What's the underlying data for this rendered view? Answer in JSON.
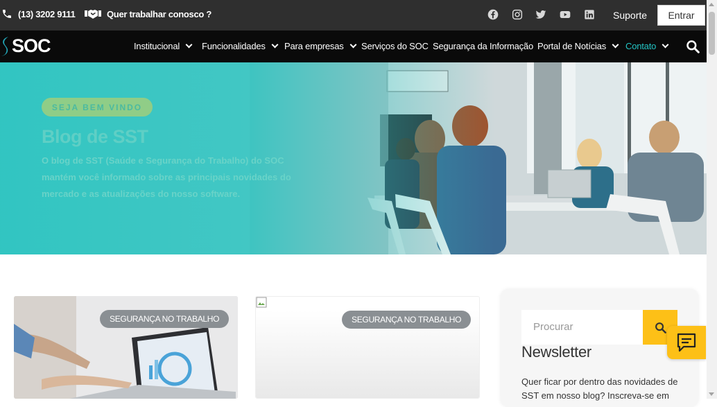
{
  "topbar": {
    "phone": "(13) 3202 9111",
    "work": "Quer trabalhar conosco ?",
    "social": [
      "facebook-icon",
      "instagram-icon",
      "twitter-icon",
      "youtube-icon",
      "linkedin-icon"
    ],
    "suporte": "Suporte",
    "entrar": "Entrar"
  },
  "navbar": {
    "logo": "SOC",
    "items": [
      {
        "label": "Institucional",
        "dropdown": true
      },
      {
        "label": "Funcionalidades",
        "dropdown": true
      },
      {
        "label": "Para empresas",
        "dropdown": true
      },
      {
        "label": "Serviços do SOC",
        "dropdown": false
      },
      {
        "label": "Segurança da Informação",
        "dropdown": false
      },
      {
        "label": "Portal de Notícias",
        "dropdown": true
      },
      {
        "label": "Contato",
        "dropdown": true,
        "active": true
      }
    ]
  },
  "hero": {
    "badge": "SEJA BEM VINDO",
    "title": "Blog de SST",
    "text": "O blog de SST (Saúde e Segurança do Trabalho) do SOC mantém você informado sobre as principais novidades do mercado e as atualizações do nosso software."
  },
  "cards": [
    {
      "category": "SEGURANÇA NO TRABALHO"
    },
    {
      "category": "SEGURANÇA NO TRABALHO"
    }
  ],
  "sidebar": {
    "search_placeholder": "Procurar",
    "newsletter_title": "Newsletter",
    "newsletter_text": "Quer ficar por dentro das novidades de SST em nosso blog? Inscreva-se em"
  },
  "colors": {
    "accent": "#23c4c4",
    "yellow": "#fdc017",
    "dark": "#0a0a0a",
    "topbar": "#2f2f2f"
  }
}
